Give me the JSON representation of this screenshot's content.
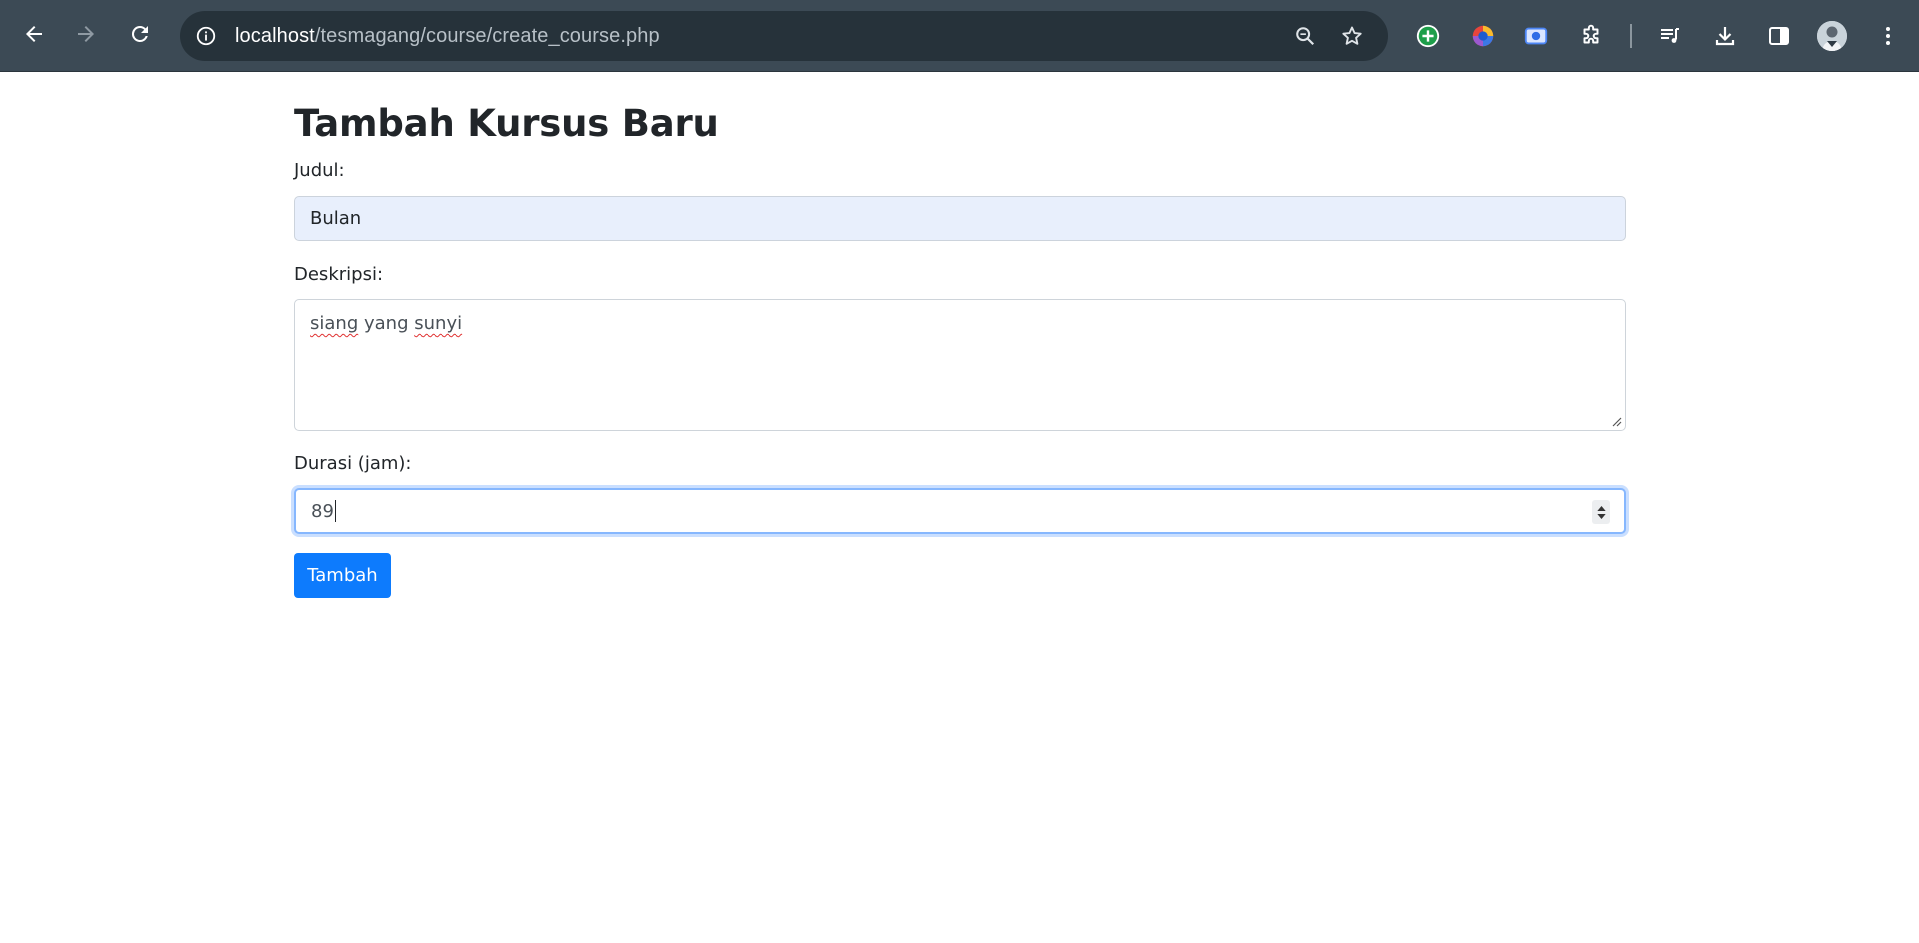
{
  "browser": {
    "url_host": "localhost",
    "url_path": "/tesmagang/course/create_course.php",
    "icons": {
      "back": "arrow-left-icon",
      "forward": "arrow-right-icon",
      "reload": "reload-icon",
      "site_info": "info-icon",
      "zoom": "magnifier-icon",
      "bookmark": "star-icon",
      "extensions": [
        "plus-circle-icon",
        "color-orb-icon",
        "screen-capture-icon",
        "puzzle-icon"
      ],
      "media": "playlist-icon",
      "downloads": "download-icon",
      "side_panel": "side-panel-icon",
      "profile": "avatar-icon",
      "menu": "kebab-menu-icon"
    }
  },
  "form": {
    "heading": "Tambah Kursus Baru",
    "title_label": "Judul:",
    "title_value": "Bulan",
    "description_label": "Deskripsi:",
    "description_words": [
      "siang",
      "yang",
      "sunyi"
    ],
    "duration_label": "Durasi (jam):",
    "duration_value": "89",
    "submit_label": "Tambah"
  },
  "colors": {
    "chrome_bg": "#3c4a55",
    "omnibox_bg": "#26323a",
    "autofill_bg": "#e8effc",
    "focus_ring": "#86b7fe",
    "primary_button": "#0d7bfd",
    "spellcheck_underline": "#e03131"
  }
}
